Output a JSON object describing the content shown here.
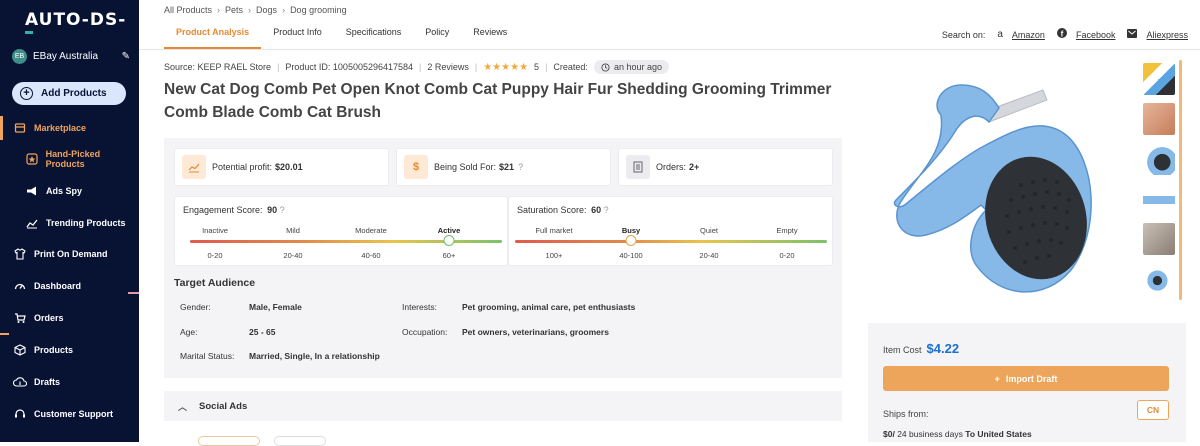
{
  "sidebar": {
    "logo": "AUTO-DS-",
    "account": {
      "initials": "EB",
      "name": "EBay Australia"
    },
    "add_products": "Add Products",
    "items": [
      {
        "label": "Marketplace",
        "icon": "store-icon"
      },
      {
        "label": "Hand-Picked Products",
        "icon": "star-box-icon"
      },
      {
        "label": "Ads Spy",
        "icon": "megaphone-icon"
      },
      {
        "label": "Trending Products",
        "icon": "trend-icon"
      },
      {
        "label": "Print On Demand",
        "icon": "shirt-icon"
      },
      {
        "label": "Dashboard",
        "icon": "gauge-icon"
      },
      {
        "label": "Orders",
        "icon": "cart-icon"
      },
      {
        "label": "Products",
        "icon": "box-icon"
      },
      {
        "label": "Drafts",
        "icon": "cloud-upload-icon"
      },
      {
        "label": "Customer Support",
        "icon": "headset-icon"
      }
    ]
  },
  "breadcrumb": [
    "All Products",
    "Pets",
    "Dogs",
    "Dog grooming"
  ],
  "tabs": [
    "Product Analysis",
    "Product Info",
    "Specifications",
    "Policy",
    "Reviews"
  ],
  "search_on": {
    "label": "Search on:",
    "links": [
      "Amazon",
      "Facebook",
      "Aliexpress"
    ]
  },
  "meta": {
    "source": "Source: KEEP RAEL Store",
    "product_id": "Product ID: 1005005296417584",
    "reviews": "2 Reviews",
    "rating": "5",
    "created_label": "Created:",
    "created_value": "an hour ago"
  },
  "title": "New Cat Dog Comb Pet Open Knot Comb Cat Puppy Hair Fur Shedding Grooming Trimmer Comb Blade Comb Cat Brush",
  "stats": {
    "profit_label": "Potential profit:",
    "profit_value": "$20.01",
    "sold_label": "Being Sold For:",
    "sold_value": "$21",
    "orders_label": "Orders:",
    "orders_value": "2+"
  },
  "engagement": {
    "label": "Engagement Score:",
    "value": "90",
    "levels": [
      "Inactive",
      "Mild",
      "Moderate",
      "Active"
    ],
    "ranges": [
      "0-20",
      "20-40",
      "40-60",
      "60+"
    ],
    "selected": "Active"
  },
  "saturation": {
    "label": "Saturation Score:",
    "value": "60",
    "levels": [
      "Full market",
      "Busy",
      "Quiet",
      "Empty"
    ],
    "ranges": [
      "100+",
      "40-100",
      "20-40",
      "0-20"
    ],
    "selected": "Busy"
  },
  "target_audience": {
    "title": "Target Audience",
    "gender_label": "Gender:",
    "gender": "Male, Female",
    "age_label": "Age:",
    "age": "25 - 65",
    "marital_label": "Marital Status:",
    "marital": "Married, Single, In a relationship",
    "interests_label": "Interests:",
    "interests": "Pet grooming, animal care, pet enthusiasts",
    "occupation_label": "Occupation:",
    "occupation": "Pet owners, veterinarians, groomers"
  },
  "social_ads": "Social Ads",
  "right": {
    "item_cost_label": "Item Cost",
    "item_cost": "$4.22",
    "import_label": "Import Draft",
    "ships_from": "Ships from:",
    "ships_from_value": "CN",
    "shipping_cost": "$0/",
    "shipping_days": "24 business days",
    "shipping_to": "To United States"
  },
  "colors": {
    "accent": "#e48a32",
    "sidebar_bg": "#081233",
    "price_blue": "#1a6fd1",
    "import_btn": "#eda55b"
  }
}
